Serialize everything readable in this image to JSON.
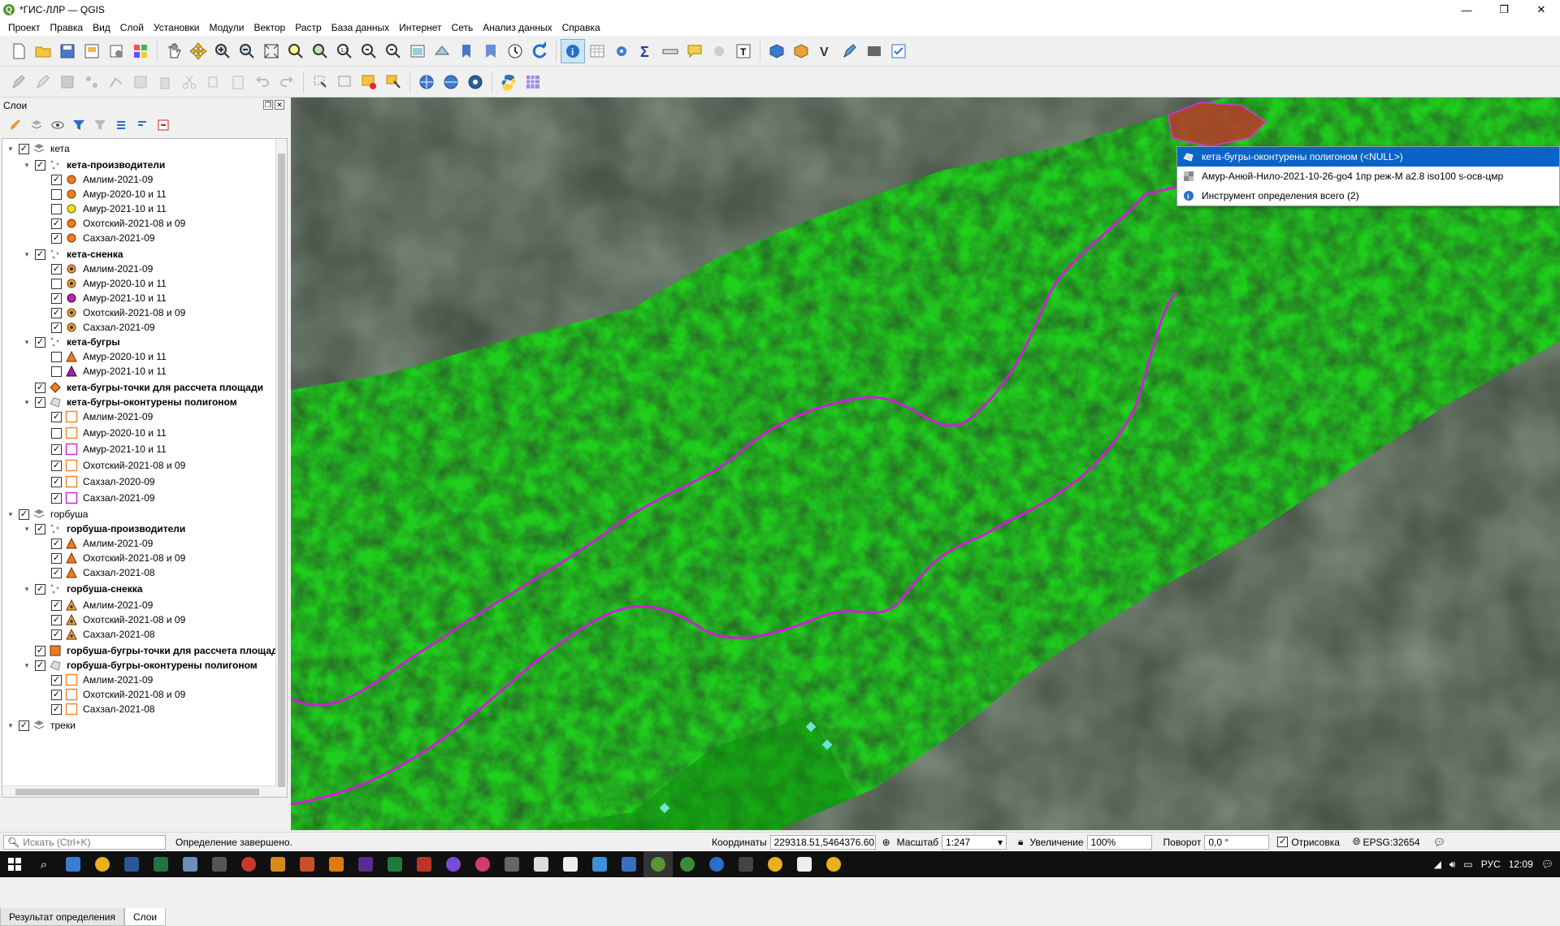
{
  "window": {
    "title": "*ГИС-ЛЛР — QGIS",
    "minimize": "—",
    "restore": "❐",
    "close": "✕"
  },
  "menu": [
    "Проект",
    "Правка",
    "Вид",
    "Слой",
    "Установки",
    "Модули",
    "Вектор",
    "Растр",
    "База данных",
    "Интернет",
    "Сеть",
    "Анализ данных",
    "Справка"
  ],
  "layers_panel": {
    "title": "Слои",
    "tree": [
      {
        "label": "кета",
        "level": 0,
        "bold": false,
        "checked": true,
        "expanded": true,
        "icon": "group-icon"
      },
      {
        "label": "кета-производители",
        "level": 1,
        "bold": true,
        "checked": true,
        "expanded": true,
        "icon": "point-layer-icon"
      },
      {
        "label": "Амлим-2021-09",
        "level": 2,
        "bold": false,
        "checked": true,
        "icon": "orange-circle-icon"
      },
      {
        "label": "Амур-2020-10 и 11",
        "level": 2,
        "bold": false,
        "checked": false,
        "icon": "orange-circle-icon"
      },
      {
        "label": "Амур-2021-10 и 11",
        "level": 2,
        "bold": false,
        "checked": false,
        "icon": "yellow-circle-icon"
      },
      {
        "label": "Охотский-2021-08 и 09",
        "level": 2,
        "bold": false,
        "checked": true,
        "icon": "orange-circle-icon"
      },
      {
        "label": "Сахзал-2021-09",
        "level": 2,
        "bold": false,
        "checked": true,
        "icon": "orange-circle-icon"
      },
      {
        "label": "кета-сненка",
        "level": 1,
        "bold": true,
        "checked": true,
        "expanded": true,
        "icon": "point-layer-icon"
      },
      {
        "label": "Амлим-2021-09",
        "level": 2,
        "bold": false,
        "checked": true,
        "icon": "dotted-circle-icon"
      },
      {
        "label": "Амур-2020-10 и 11",
        "level": 2,
        "bold": false,
        "checked": false,
        "icon": "dotted-circle-icon"
      },
      {
        "label": "Амур-2021-10 и 11",
        "level": 2,
        "bold": false,
        "checked": true,
        "icon": "purple-circle-icon"
      },
      {
        "label": "Охотский-2021-08 и 09",
        "level": 2,
        "bold": false,
        "checked": true,
        "icon": "dotted-circle-icon"
      },
      {
        "label": "Сахзал-2021-09",
        "level": 2,
        "bold": false,
        "checked": true,
        "icon": "dotted-circle-icon"
      },
      {
        "label": "кета-бугры",
        "level": 1,
        "bold": true,
        "checked": true,
        "expanded": true,
        "icon": "point-layer-icon"
      },
      {
        "label": "Амур-2020-10 и 11",
        "level": 2,
        "bold": false,
        "checked": false,
        "icon": "orange-triangle-icon"
      },
      {
        "label": "Амур-2021-10 и 11",
        "level": 2,
        "bold": false,
        "checked": false,
        "icon": "purple-triangle-icon"
      },
      {
        "label": "кета-бугры-точки для рассчета площади",
        "level": 1,
        "bold": true,
        "checked": true,
        "noexp": true,
        "icon": "orange-diamond-icon"
      },
      {
        "label": "кета-бугры-оконтурены полигоном",
        "level": 1,
        "bold": true,
        "checked": true,
        "expanded": true,
        "icon": "polygon-layer-icon"
      },
      {
        "label": "Амлим-2021-09",
        "level": 2,
        "bold": false,
        "checked": true,
        "icon": "orange-square-outline-icon"
      },
      {
        "label": "Амур-2020-10 и 11",
        "level": 2,
        "bold": false,
        "checked": false,
        "icon": "orange-square-outline-icon"
      },
      {
        "label": "Амур-2021-10 и 11",
        "level": 2,
        "bold": false,
        "checked": true,
        "icon": "magenta-square-outline-icon"
      },
      {
        "label": "Охотский-2021-08 и 09",
        "level": 2,
        "bold": false,
        "checked": true,
        "icon": "orange-square-outline-icon"
      },
      {
        "label": "Сахзал-2020-09",
        "level": 2,
        "bold": false,
        "checked": true,
        "icon": "orange-square-outline-icon"
      },
      {
        "label": "Сахзал-2021-09",
        "level": 2,
        "bold": false,
        "checked": true,
        "icon": "magenta-square-outline-icon"
      },
      {
        "label": "горбуша",
        "level": 0,
        "bold": false,
        "checked": true,
        "expanded": true,
        "icon": "group-icon"
      },
      {
        "label": "горбуша-производители",
        "level": 1,
        "bold": true,
        "checked": true,
        "expanded": true,
        "icon": "point-layer-icon"
      },
      {
        "label": "Амлим-2021-09",
        "level": 2,
        "bold": false,
        "checked": true,
        "icon": "orange-triangle-icon"
      },
      {
        "label": "Охотский-2021-08 и 09",
        "level": 2,
        "bold": false,
        "checked": true,
        "icon": "orange-triangle-icon"
      },
      {
        "label": "Сахзал-2021-08",
        "level": 2,
        "bold": false,
        "checked": true,
        "icon": "orange-triangle-icon"
      },
      {
        "label": "горбуша-снекка",
        "level": 1,
        "bold": true,
        "checked": true,
        "expanded": true,
        "icon": "point-layer-icon"
      },
      {
        "label": "Амлим-2021-09",
        "level": 2,
        "bold": false,
        "checked": true,
        "icon": "dotted-triangle-icon"
      },
      {
        "label": "Охотский-2021-08 и 09",
        "level": 2,
        "bold": false,
        "checked": true,
        "icon": "dotted-triangle-icon"
      },
      {
        "label": "Сахзал-2021-08",
        "level": 2,
        "bold": false,
        "checked": true,
        "icon": "dotted-triangle-icon"
      },
      {
        "label": "горбуша-бугры-точки для рассчета площад",
        "level": 1,
        "bold": true,
        "checked": true,
        "noexp": true,
        "icon": "orange-square-icon"
      },
      {
        "label": "горбуша-бугры-оконтурены полигоном",
        "level": 1,
        "bold": true,
        "checked": true,
        "expanded": true,
        "icon": "polygon-layer-icon"
      },
      {
        "label": "Амлим-2021-09",
        "level": 2,
        "bold": false,
        "checked": true,
        "icon": "orange-square-outline-icon"
      },
      {
        "label": "Охотский-2021-08 и 09",
        "level": 2,
        "bold": false,
        "checked": true,
        "icon": "orange-square-outline-icon"
      },
      {
        "label": "Сахзал-2021-08",
        "level": 2,
        "bold": false,
        "checked": true,
        "icon": "orange-square-outline-icon"
      },
      {
        "label": "треки",
        "level": 0,
        "bold": false,
        "checked": true,
        "expanded": true,
        "icon": "group-icon"
      }
    ]
  },
  "bottom_tabs": [
    "Результат определения",
    "Слои"
  ],
  "identify_popup": {
    "items": [
      {
        "label": "кета-бугры-оконтурены полигоном (<NULL>)",
        "icon": "polygon-layer-icon",
        "selected": true
      },
      {
        "label": "Амур-Анюй-Нило-2021-10-26-go4 1пр реж-M a2.8 iso100 s-осв-цмр",
        "icon": "raster-layer-icon",
        "selected": false
      },
      {
        "label": "Инструмент определения всего (2)",
        "icon": "info-icon",
        "selected": false
      }
    ]
  },
  "status": {
    "search_placeholder": "Искать (Ctrl+K)",
    "message": "Определение завершено.",
    "coord_label": "Координаты",
    "coord_value": "229318.51,5464376.60",
    "scale_label": "Масштаб",
    "scale_value": "1:247",
    "magnifier_label": "Увеличение",
    "magnifier_value": "100%",
    "rotation_label": "Поворот",
    "rotation_value": "0,0 °",
    "render_label": "Отрисовка",
    "crs": "EPSG:32654"
  },
  "taskbar": {
    "lang": "РУС",
    "time": "12:09"
  },
  "colors": {
    "accent": "#0a64c8",
    "polygon": "#d020e0",
    "raster_green": "#22d31e",
    "point_cyan": "#6fe3d5"
  }
}
